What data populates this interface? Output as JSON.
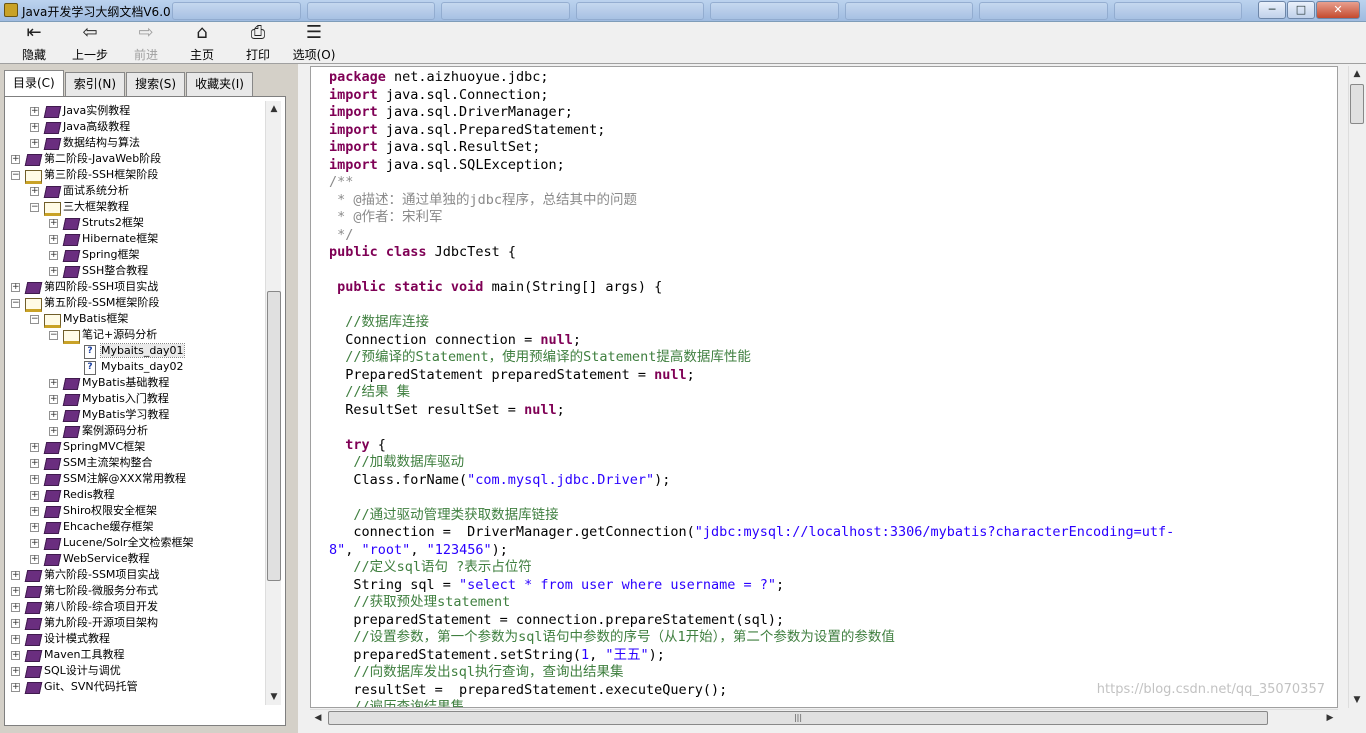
{
  "window": {
    "title": "Java开发学习大纲文档V6.0",
    "controls": {
      "minimize": "─",
      "maximize": "□",
      "close": "✕"
    }
  },
  "toolbar": {
    "buttons": [
      {
        "label": "隐藏",
        "icon": "hide-panel-icon",
        "glyph": "⇤",
        "enabled": true
      },
      {
        "label": "上一步",
        "icon": "back-arrow-icon",
        "glyph": "⇦",
        "enabled": true
      },
      {
        "label": "前进",
        "icon": "forward-arrow-icon",
        "glyph": "⇨",
        "enabled": false
      },
      {
        "label": "主页",
        "icon": "home-icon",
        "glyph": "⌂",
        "enabled": true
      },
      {
        "label": "打印",
        "icon": "printer-icon",
        "glyph": "⎙",
        "enabled": true
      },
      {
        "label": "选项(O)",
        "icon": "options-icon",
        "glyph": "☰",
        "enabled": true
      }
    ]
  },
  "nav_tabs": [
    {
      "label": "目录(C)",
      "active": true
    },
    {
      "label": "索引(N)",
      "active": false
    },
    {
      "label": "搜索(S)",
      "active": false
    },
    {
      "label": "收藏夹(I)",
      "active": false
    }
  ],
  "tree": {
    "items": [
      {
        "label": "Java实例教程",
        "level": 1,
        "state": "collapsed",
        "icon": "closed-book"
      },
      {
        "label": "Java高级教程",
        "level": 1,
        "state": "collapsed",
        "icon": "closed-book"
      },
      {
        "label": "数据结构与算法",
        "level": 1,
        "state": "collapsed",
        "icon": "closed-book"
      },
      {
        "label": "第二阶段-JavaWeb阶段",
        "level": 0,
        "state": "collapsed",
        "icon": "closed-book"
      },
      {
        "label": "第三阶段-SSH框架阶段",
        "level": 0,
        "state": "expanded",
        "icon": "open-book"
      },
      {
        "label": "面试系统分析",
        "level": 1,
        "state": "collapsed",
        "icon": "closed-book"
      },
      {
        "label": "三大框架教程",
        "level": 1,
        "state": "expanded",
        "icon": "open-book"
      },
      {
        "label": "Struts2框架",
        "level": 2,
        "state": "collapsed",
        "icon": "closed-book"
      },
      {
        "label": "Hibernate框架",
        "level": 2,
        "state": "collapsed",
        "icon": "closed-book"
      },
      {
        "label": "Spring框架",
        "level": 2,
        "state": "collapsed",
        "icon": "closed-book"
      },
      {
        "label": "SSH整合教程",
        "level": 2,
        "state": "collapsed",
        "icon": "closed-book"
      },
      {
        "label": "第四阶段-SSH项目实战",
        "level": 0,
        "state": "collapsed",
        "icon": "closed-book"
      },
      {
        "label": "第五阶段-SSM框架阶段",
        "level": 0,
        "state": "expanded",
        "icon": "open-book"
      },
      {
        "label": "MyBatis框架",
        "level": 1,
        "state": "expanded",
        "icon": "open-book"
      },
      {
        "label": "笔记+源码分析",
        "level": 2,
        "state": "expanded",
        "icon": "open-book"
      },
      {
        "label": "Mybaits_day01",
        "level": 3,
        "state": "leaf",
        "icon": "page",
        "selected": true
      },
      {
        "label": "Mybaits_day02",
        "level": 3,
        "state": "leaf",
        "icon": "page"
      },
      {
        "label": "MyBatis基础教程",
        "level": 2,
        "state": "collapsed",
        "icon": "closed-book"
      },
      {
        "label": "Mybatis入门教程",
        "level": 2,
        "state": "collapsed",
        "icon": "closed-book"
      },
      {
        "label": "MyBatis学习教程",
        "level": 2,
        "state": "collapsed",
        "icon": "closed-book"
      },
      {
        "label": "案例源码分析",
        "level": 2,
        "state": "collapsed",
        "icon": "closed-book"
      },
      {
        "label": "SpringMVC框架",
        "level": 1,
        "state": "collapsed",
        "icon": "closed-book"
      },
      {
        "label": "SSM主流架构整合",
        "level": 1,
        "state": "collapsed",
        "icon": "closed-book"
      },
      {
        "label": "SSM注解@XXX常用教程",
        "level": 1,
        "state": "collapsed",
        "icon": "closed-book"
      },
      {
        "label": "Redis教程",
        "level": 1,
        "state": "collapsed",
        "icon": "closed-book"
      },
      {
        "label": "Shiro权限安全框架",
        "level": 1,
        "state": "collapsed",
        "icon": "closed-book"
      },
      {
        "label": "Ehcache缓存框架",
        "level": 1,
        "state": "collapsed",
        "icon": "closed-book"
      },
      {
        "label": "Lucene/Solr全文检索框架",
        "level": 1,
        "state": "collapsed",
        "icon": "closed-book"
      },
      {
        "label": "WebService教程",
        "level": 1,
        "state": "collapsed",
        "icon": "closed-book"
      },
      {
        "label": "第六阶段-SSM项目实战",
        "level": 0,
        "state": "collapsed",
        "icon": "closed-book"
      },
      {
        "label": "第七阶段-微服务分布式",
        "level": 0,
        "state": "collapsed",
        "icon": "closed-book"
      },
      {
        "label": "第八阶段-综合项目开发",
        "level": 0,
        "state": "collapsed",
        "icon": "closed-book"
      },
      {
        "label": "第九阶段-开源项目架构",
        "level": 0,
        "state": "collapsed",
        "icon": "closed-book"
      },
      {
        "label": "设计模式教程",
        "level": 0,
        "state": "collapsed",
        "icon": "closed-book"
      },
      {
        "label": "Maven工具教程",
        "level": 0,
        "state": "collapsed",
        "icon": "closed-book"
      },
      {
        "label": "SQL设计与调优",
        "level": 0,
        "state": "collapsed",
        "icon": "closed-book"
      },
      {
        "label": "Git、SVN代码托管",
        "level": 0,
        "state": "collapsed",
        "icon": "closed-book"
      }
    ]
  },
  "code": {
    "lines": [
      [
        [
          "k",
          "package"
        ],
        [
          "t",
          " net.aizhuoyue.jdbc;"
        ]
      ],
      [
        [
          "k",
          "import"
        ],
        [
          "t",
          " java.sql.Connection;"
        ]
      ],
      [
        [
          "k",
          "import"
        ],
        [
          "t",
          " java.sql.DriverManager;"
        ]
      ],
      [
        [
          "k",
          "import"
        ],
        [
          "t",
          " java.sql.PreparedStatement;"
        ]
      ],
      [
        [
          "k",
          "import"
        ],
        [
          "t",
          " java.sql.ResultSet;"
        ]
      ],
      [
        [
          "k",
          "import"
        ],
        [
          "t",
          " java.sql.SQLException;"
        ]
      ],
      [
        [
          "c",
          "/**"
        ]
      ],
      [
        [
          "c",
          " * @描述：通过单独的jdbc程序，总结其中的问题"
        ]
      ],
      [
        [
          "c",
          " * @作者：宋利军"
        ]
      ],
      [
        [
          "c",
          " */"
        ]
      ],
      [
        [
          "k",
          "public class"
        ],
        [
          "t",
          " JdbcTest {"
        ]
      ],
      [
        [
          "t",
          ""
        ]
      ],
      [
        [
          "t",
          " "
        ],
        [
          "k",
          "public static void"
        ],
        [
          "t",
          " main(String[] args) {"
        ]
      ],
      [
        [
          "t",
          ""
        ]
      ],
      [
        [
          "t",
          "  "
        ],
        [
          "g",
          "//数据库连接"
        ]
      ],
      [
        [
          "t",
          "  Connection connection = "
        ],
        [
          "k",
          "null"
        ],
        [
          "t",
          ";"
        ]
      ],
      [
        [
          "t",
          "  "
        ],
        [
          "g",
          "//预编译的Statement，使用预编译的Statement提高数据库性能"
        ]
      ],
      [
        [
          "t",
          "  PreparedStatement preparedStatement = "
        ],
        [
          "k",
          "null"
        ],
        [
          "t",
          ";"
        ]
      ],
      [
        [
          "t",
          "  "
        ],
        [
          "g",
          "//结果 集"
        ]
      ],
      [
        [
          "t",
          "  ResultSet resultSet = "
        ],
        [
          "k",
          "null"
        ],
        [
          "t",
          ";"
        ]
      ],
      [
        [
          "t",
          ""
        ]
      ],
      [
        [
          "t",
          "  "
        ],
        [
          "k",
          "try"
        ],
        [
          "t",
          " {"
        ]
      ],
      [
        [
          "t",
          "   "
        ],
        [
          "g",
          "//加载数据库驱动"
        ]
      ],
      [
        [
          "t",
          "   Class.forName("
        ],
        [
          "s",
          "\"com.mysql.jdbc.Driver\""
        ],
        [
          "t",
          ");"
        ]
      ],
      [
        [
          "t",
          ""
        ]
      ],
      [
        [
          "t",
          "   "
        ],
        [
          "g",
          "//通过驱动管理类获取数据库链接"
        ]
      ],
      [
        [
          "t",
          "   connection =  DriverManager.getConnection("
        ],
        [
          "s",
          "\"jdbc:mysql://localhost:3306/mybatis?characterEncoding=utf-"
        ]
      ],
      [
        [
          "s",
          "8\""
        ],
        [
          "t",
          ", "
        ],
        [
          "s",
          "\"root\""
        ],
        [
          "t",
          ", "
        ],
        [
          "s",
          "\"123456\""
        ],
        [
          "t",
          ");"
        ]
      ],
      [
        [
          "t",
          "   "
        ],
        [
          "g",
          "//定义sql语句 ?表示占位符"
        ]
      ],
      [
        [
          "t",
          "   String sql = "
        ],
        [
          "s",
          "\"select * from user where username = ?\""
        ],
        [
          "t",
          ";"
        ]
      ],
      [
        [
          "t",
          "   "
        ],
        [
          "g",
          "//获取预处理statement"
        ]
      ],
      [
        [
          "t",
          "   preparedStatement = connection.prepareStatement(sql);"
        ]
      ],
      [
        [
          "t",
          "   "
        ],
        [
          "g",
          "//设置参数，第一个参数为sql语句中参数的序号（从1开始），第二个参数为设置的参数值"
        ]
      ],
      [
        [
          "t",
          "   preparedStatement.setString("
        ],
        [
          "s",
          "1"
        ],
        [
          "t",
          ", "
        ],
        [
          "s",
          "\"王五\""
        ],
        [
          "t",
          ");"
        ]
      ],
      [
        [
          "t",
          "   "
        ],
        [
          "g",
          "//向数据库发出sql执行查询，查询出结果集"
        ]
      ],
      [
        [
          "t",
          "   resultSet =  preparedStatement.executeQuery();"
        ]
      ],
      [
        [
          "t",
          "   "
        ],
        [
          "g",
          "//遍历查询结果集"
        ]
      ]
    ]
  },
  "watermark": "https://blog.csdn.net/qq_35070357",
  "colors": {
    "keyword": "#7f0055",
    "comment": "#8a8a8a",
    "line_comment": "#3f7f3f",
    "string": "#2a00ff"
  }
}
